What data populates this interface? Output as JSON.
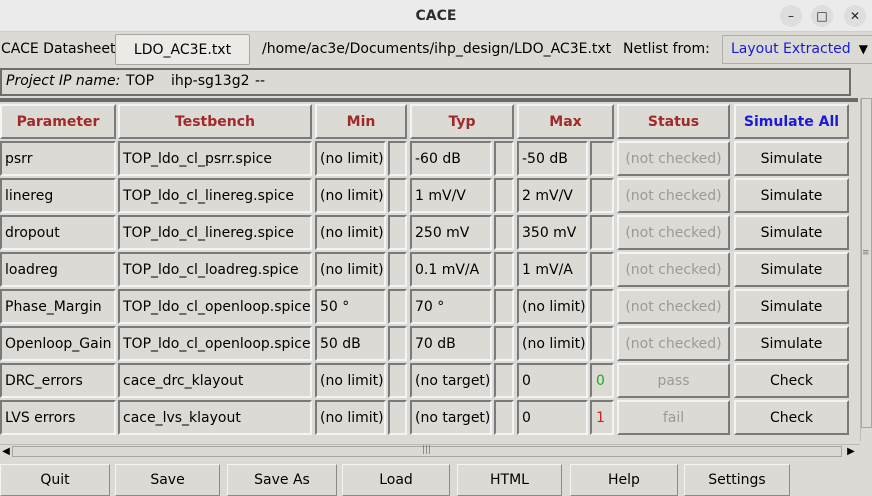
{
  "window": {
    "title": "CACE"
  },
  "toolbar": {
    "datasheet_label": "CACE Datasheet:",
    "datasheet_file": "LDO_AC3E.txt",
    "datasheet_path": "/home/ac3e/Documents/ihp_design/LDO_AC3E.txt",
    "netlist_label": "Netlist from:",
    "netlist_value": "Layout Extracted"
  },
  "project": {
    "label": "Project IP name:",
    "name": "TOP",
    "pdk": "ihp-sg13g2",
    "extra": "--"
  },
  "table": {
    "headers": {
      "parameter": "Parameter",
      "testbench": "Testbench",
      "min": "Min",
      "typ": "Typ",
      "max": "Max",
      "status": "Status",
      "simulate_all": "Simulate All"
    },
    "rows": [
      {
        "parameter": "psrr",
        "testbench": "TOP_ldo_cl_psrr.spice",
        "min": "(no limit)",
        "typ": "-60 dB",
        "max": "-50 dB",
        "flag": "",
        "status": "(not checked)",
        "action": "Simulate"
      },
      {
        "parameter": "linereg",
        "testbench": "TOP_ldo_cl_linereg.spice",
        "min": "(no limit)",
        "typ": "1 mV/V",
        "max": "2 mV/V",
        "flag": "",
        "status": "(not checked)",
        "action": "Simulate"
      },
      {
        "parameter": "dropout",
        "testbench": "TOP_ldo_cl_linereg.spice",
        "min": "(no limit)",
        "typ": "250 mV",
        "max": "350 mV",
        "flag": "",
        "status": "(not checked)",
        "action": "Simulate"
      },
      {
        "parameter": "loadreg",
        "testbench": "TOP_ldo_cl_loadreg.spice",
        "min": "(no limit)",
        "typ": "0.1 mV/A",
        "max": "1 mV/A",
        "flag": "",
        "status": "(not checked)",
        "action": "Simulate"
      },
      {
        "parameter": "Phase_Margin",
        "testbench": "TOP_ldo_cl_openloop.spice",
        "min": "50 °",
        "typ": "70 °",
        "max": "(no limit)",
        "flag": "",
        "status": "(not checked)",
        "action": "Simulate"
      },
      {
        "parameter": "Openloop_Gain",
        "testbench": "TOP_ldo_cl_openloop.spice",
        "min": "50 dB",
        "typ": "70 dB",
        "max": "(no limit)",
        "flag": "",
        "status": "(not checked)",
        "action": "Simulate"
      },
      {
        "parameter": "DRC_errors",
        "testbench": "cace_drc_klayout",
        "min": "(no limit)",
        "typ": "(no target)",
        "max": "0",
        "flag": "0",
        "status": "pass",
        "action": "Check"
      },
      {
        "parameter": "LVS errors",
        "testbench": "cace_lvs_klayout",
        "min": "(no limit)",
        "typ": "(no target)",
        "max": "0",
        "flag": "1",
        "status": "fail",
        "action": "Check"
      }
    ]
  },
  "footer": {
    "quit": "Quit",
    "save": "Save",
    "save_as": "Save As",
    "load": "Load",
    "html": "HTML",
    "help": "Help",
    "settings": "Settings"
  },
  "colors": {
    "header_text": "#a02a2a",
    "simulate_all_text": "#1a1adb",
    "netlist_text": "#1a1adb",
    "flag_pass": "#22aa22",
    "flag_fail": "#cc2222"
  }
}
